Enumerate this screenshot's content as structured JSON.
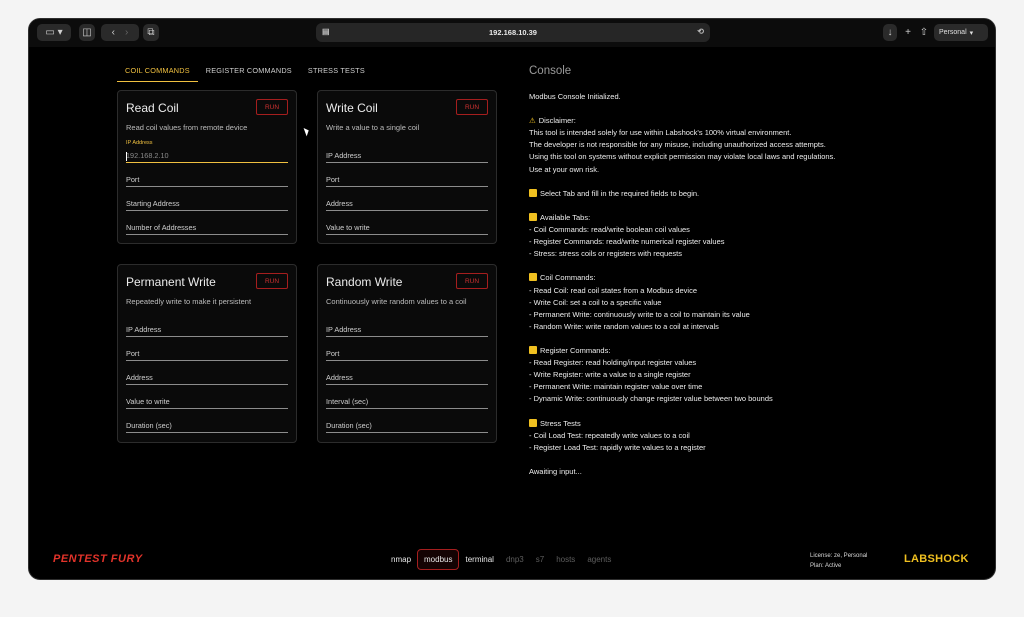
{
  "browser": {
    "url": "192.168.10.39",
    "profile": "Personal"
  },
  "tabs": [
    {
      "label": "COIL COMMANDS",
      "active": true
    },
    {
      "label": "REGISTER COMMANDS",
      "active": false
    },
    {
      "label": "STRESS TESTS",
      "active": false
    }
  ],
  "cards": {
    "read_coil": {
      "title": "Read Coil",
      "run": "RUN",
      "desc": "Read coil values from remote device",
      "float_label": "IP Address",
      "fields": [
        "192.168.2.10",
        "Port",
        "Starting Address",
        "Number of Addresses"
      ]
    },
    "write_coil": {
      "title": "Write Coil",
      "run": "RUN",
      "desc": "Write a value to a single coil",
      "fields": [
        "IP Address",
        "Port",
        "Address",
        "Value to write"
      ]
    },
    "permanent_write": {
      "title": "Permanent Write",
      "run": "RUN",
      "desc": "Repeatedly write to make it persistent",
      "fields": [
        "IP Address",
        "Port",
        "Address",
        "Value to write",
        "Duration (sec)"
      ]
    },
    "random_write": {
      "title": "Random Write",
      "run": "RUN",
      "desc": "Continuously write random values to a coil",
      "fields": [
        "IP Address",
        "Port",
        "Address",
        "Interval (sec)",
        "Duration (sec)"
      ]
    }
  },
  "console": {
    "title": "Console",
    "lines": [
      "Modbus Console Initialized.",
      "",
      "[warn]Disclaimer:",
      "This tool is intended solely for use within Labshock's 100% virtual environment.",
      "The developer is not responsible for any misuse, including unauthorized access attempts.",
      "Using this tool on systems without explicit permission may violate local laws and regulations.",
      "Use at your own risk.",
      "",
      "[box]Select Tab and fill in the required fields to begin.",
      "",
      "[box]Available Tabs:",
      "- Coil Commands: read/write boolean coil values",
      "- Register Commands: read/write numerical register values",
      "- Stress: stress coils or registers with requests",
      "",
      "[box]Coil Commands:",
      "- Read Coil: read coil states from a Modbus device",
      "- Write Coil: set a coil to a specific value",
      "- Permanent Write: continuously write to a coil to maintain its value",
      "- Random Write: write random values to a coil at intervals",
      "",
      "[box]Register Commands:",
      "- Read Register: read holding/input register values",
      "- Write Register: write a value to a single register",
      "- Permanent Write: maintain register value over time",
      "- Dynamic Write: continuously change register value between two bounds",
      "",
      "[box]Stress Tests",
      "- Coil Load Test: repeatedly write values to a coil",
      "- Register Load Test: rapidly write values to a register",
      "",
      "Awaiting input..."
    ]
  },
  "footer": {
    "brand_left": "PENTEST FURY",
    "brand_right": "LABSHOCK",
    "nav": [
      {
        "label": "nmap",
        "state": "on"
      },
      {
        "label": "modbus",
        "state": "active"
      },
      {
        "label": "terminal",
        "state": "on"
      },
      {
        "label": "dnp3",
        "state": "off"
      },
      {
        "label": "s7",
        "state": "off"
      },
      {
        "label": "hosts",
        "state": "off"
      },
      {
        "label": "agents",
        "state": "off"
      }
    ],
    "license_line1": "License: ze, Personal",
    "license_line2": "Plan: Active"
  },
  "colors": {
    "accent": "#f0c040",
    "danger": "#d03030",
    "background": "#000000"
  }
}
